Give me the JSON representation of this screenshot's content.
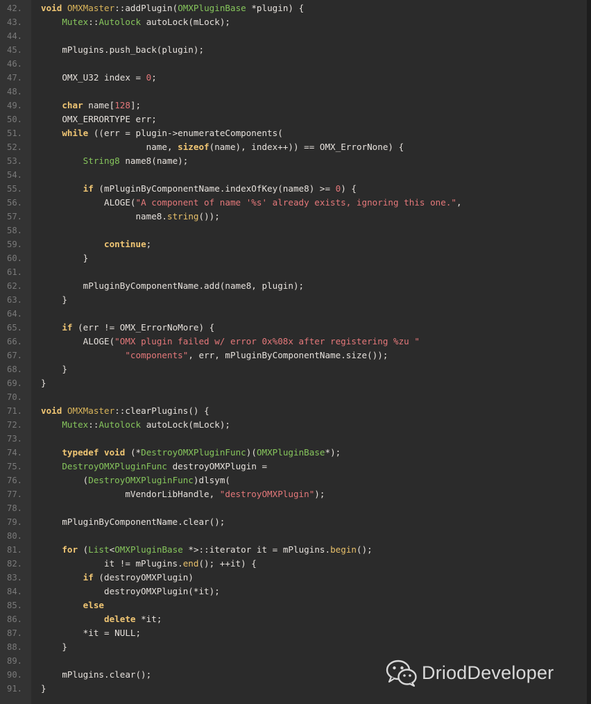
{
  "code": {
    "lines": [
      {
        "n": "42.",
        "tokens": [
          [
            "void",
            "kw"
          ],
          [
            " ",
            ""
          ],
          [
            "OMXMaster",
            "cls"
          ],
          [
            "::addPlugin(",
            ""
          ],
          [
            "OMXPluginBase",
            "ty"
          ],
          [
            " *plugin) {",
            ""
          ]
        ]
      },
      {
        "n": "43.",
        "tokens": [
          [
            "    ",
            ""
          ],
          [
            "Mutex",
            "ty"
          ],
          [
            "::",
            ""
          ],
          [
            "Autolock",
            "ty"
          ],
          [
            " autoLock(mLock);",
            ""
          ]
        ]
      },
      {
        "n": "44.",
        "tokens": []
      },
      {
        "n": "45.",
        "tokens": [
          [
            "    mPlugins.push_back(plugin);",
            ""
          ]
        ]
      },
      {
        "n": "46.",
        "tokens": []
      },
      {
        "n": "47.",
        "tokens": [
          [
            "    OMX_U32 index = ",
            ""
          ],
          [
            "0",
            "num"
          ],
          [
            ";",
            ""
          ]
        ]
      },
      {
        "n": "48.",
        "tokens": []
      },
      {
        "n": "49.",
        "tokens": [
          [
            "    ",
            ""
          ],
          [
            "char",
            "kw"
          ],
          [
            " name[",
            ""
          ],
          [
            "128",
            "num"
          ],
          [
            "];",
            ""
          ]
        ]
      },
      {
        "n": "50.",
        "tokens": [
          [
            "    OMX_ERRORTYPE err;",
            ""
          ]
        ]
      },
      {
        "n": "51.",
        "tokens": [
          [
            "    ",
            ""
          ],
          [
            "while",
            "kw"
          ],
          [
            " ((err = plugin->enumerateComponents(",
            ""
          ]
        ]
      },
      {
        "n": "52.",
        "tokens": [
          [
            "                    name, ",
            ""
          ],
          [
            "sizeof",
            "kw"
          ],
          [
            "(name), index++)) == OMX_ErrorNone) {",
            ""
          ]
        ]
      },
      {
        "n": "53.",
        "tokens": [
          [
            "        ",
            ""
          ],
          [
            "String8",
            "ty"
          ],
          [
            " name8(name);",
            ""
          ]
        ]
      },
      {
        "n": "54.",
        "tokens": []
      },
      {
        "n": "55.",
        "tokens": [
          [
            "        ",
            ""
          ],
          [
            "if",
            "kw"
          ],
          [
            " (mPluginByComponentName.indexOfKey(name8) >= ",
            ""
          ],
          [
            "0",
            "num"
          ],
          [
            ") {",
            ""
          ]
        ]
      },
      {
        "n": "56.",
        "tokens": [
          [
            "            ALOGE(",
            ""
          ],
          [
            "\"A component of name '%s' already exists, ignoring this one.\"",
            "str"
          ],
          [
            ",",
            ""
          ]
        ]
      },
      {
        "n": "57.",
        "tokens": [
          [
            "                  name8.",
            ""
          ],
          [
            "string",
            "fn"
          ],
          [
            "());",
            ""
          ]
        ]
      },
      {
        "n": "58.",
        "tokens": []
      },
      {
        "n": "59.",
        "tokens": [
          [
            "            ",
            ""
          ],
          [
            "continue",
            "kw"
          ],
          [
            ";",
            ""
          ]
        ]
      },
      {
        "n": "60.",
        "tokens": [
          [
            "        }",
            ""
          ]
        ]
      },
      {
        "n": "61.",
        "tokens": []
      },
      {
        "n": "62.",
        "tokens": [
          [
            "        mPluginByComponentName.add(name8, plugin);",
            ""
          ]
        ]
      },
      {
        "n": "63.",
        "tokens": [
          [
            "    }",
            ""
          ]
        ]
      },
      {
        "n": "64.",
        "tokens": []
      },
      {
        "n": "65.",
        "tokens": [
          [
            "    ",
            ""
          ],
          [
            "if",
            "kw"
          ],
          [
            " (err != OMX_ErrorNoMore) {",
            ""
          ]
        ]
      },
      {
        "n": "66.",
        "tokens": [
          [
            "        ALOGE(",
            ""
          ],
          [
            "\"OMX plugin failed w/ error 0x%08x after registering %zu \"",
            "str"
          ]
        ]
      },
      {
        "n": "67.",
        "tokens": [
          [
            "                ",
            ""
          ],
          [
            "\"components\"",
            "str"
          ],
          [
            ", err, mPluginByComponentName.size());",
            ""
          ]
        ]
      },
      {
        "n": "68.",
        "tokens": [
          [
            "    }",
            ""
          ]
        ]
      },
      {
        "n": "69.",
        "tokens": [
          [
            "}",
            ""
          ]
        ]
      },
      {
        "n": "70.",
        "tokens": []
      },
      {
        "n": "71.",
        "tokens": [
          [
            "void",
            "kw"
          ],
          [
            " ",
            ""
          ],
          [
            "OMXMaster",
            "cls"
          ],
          [
            "::clearPlugins() {",
            ""
          ]
        ]
      },
      {
        "n": "72.",
        "tokens": [
          [
            "    ",
            ""
          ],
          [
            "Mutex",
            "ty"
          ],
          [
            "::",
            ""
          ],
          [
            "Autolock",
            "ty"
          ],
          [
            " autoLock(mLock);",
            ""
          ]
        ]
      },
      {
        "n": "73.",
        "tokens": []
      },
      {
        "n": "74.",
        "tokens": [
          [
            "    ",
            ""
          ],
          [
            "typedef",
            "kw"
          ],
          [
            " ",
            ""
          ],
          [
            "void",
            "kw"
          ],
          [
            " (*",
            ""
          ],
          [
            "DestroyOMXPluginFunc",
            "ty"
          ],
          [
            ")(",
            ""
          ],
          [
            "OMXPluginBase",
            "ty"
          ],
          [
            "*);",
            ""
          ]
        ]
      },
      {
        "n": "75.",
        "tokens": [
          [
            "    ",
            ""
          ],
          [
            "DestroyOMXPluginFunc",
            "ty"
          ],
          [
            " destroyOMXPlugin =",
            ""
          ]
        ]
      },
      {
        "n": "76.",
        "tokens": [
          [
            "        (",
            ""
          ],
          [
            "DestroyOMXPluginFunc",
            "ty"
          ],
          [
            ")dlsym(",
            ""
          ]
        ]
      },
      {
        "n": "77.",
        "tokens": [
          [
            "                mVendorLibHandle, ",
            ""
          ],
          [
            "\"destroyOMXPlugin\"",
            "str"
          ],
          [
            ");",
            ""
          ]
        ]
      },
      {
        "n": "78.",
        "tokens": []
      },
      {
        "n": "79.",
        "tokens": [
          [
            "    mPluginByComponentName.clear();",
            ""
          ]
        ]
      },
      {
        "n": "80.",
        "tokens": []
      },
      {
        "n": "81.",
        "tokens": [
          [
            "    ",
            ""
          ],
          [
            "for",
            "kw"
          ],
          [
            " (",
            ""
          ],
          [
            "List",
            "ty"
          ],
          [
            "<",
            ""
          ],
          [
            "OMXPluginBase",
            "ty"
          ],
          [
            " *>::iterator it = mPlugins.",
            ""
          ],
          [
            "begin",
            "fn"
          ],
          [
            "();",
            ""
          ]
        ]
      },
      {
        "n": "82.",
        "tokens": [
          [
            "            it != mPlugins.",
            ""
          ],
          [
            "end",
            "fn"
          ],
          [
            "(); ++it) {",
            ""
          ]
        ]
      },
      {
        "n": "83.",
        "tokens": [
          [
            "        ",
            ""
          ],
          [
            "if",
            "kw"
          ],
          [
            " (destroyOMXPlugin)",
            ""
          ]
        ]
      },
      {
        "n": "84.",
        "tokens": [
          [
            "            destroyOMXPlugin(*it);",
            ""
          ]
        ]
      },
      {
        "n": "85.",
        "tokens": [
          [
            "        ",
            ""
          ],
          [
            "else",
            "kw"
          ]
        ]
      },
      {
        "n": "86.",
        "tokens": [
          [
            "            ",
            ""
          ],
          [
            "delete",
            "kw"
          ],
          [
            " *it;",
            ""
          ]
        ]
      },
      {
        "n": "87.",
        "tokens": [
          [
            "        *it = NULL;",
            ""
          ]
        ]
      },
      {
        "n": "88.",
        "tokens": [
          [
            "    }",
            ""
          ]
        ]
      },
      {
        "n": "89.",
        "tokens": []
      },
      {
        "n": "90.",
        "tokens": [
          [
            "    mPlugins.clear();",
            ""
          ]
        ]
      },
      {
        "n": "91.",
        "tokens": [
          [
            "}",
            ""
          ]
        ]
      }
    ]
  },
  "watermark": {
    "icon": "wechat-icon",
    "text": "DriodDeveloper"
  },
  "colors": {
    "background": "#2b2b2b",
    "gutter": "#333333",
    "keyword": "#f0c674",
    "type": "#86c55c",
    "string": "#e4787a"
  }
}
